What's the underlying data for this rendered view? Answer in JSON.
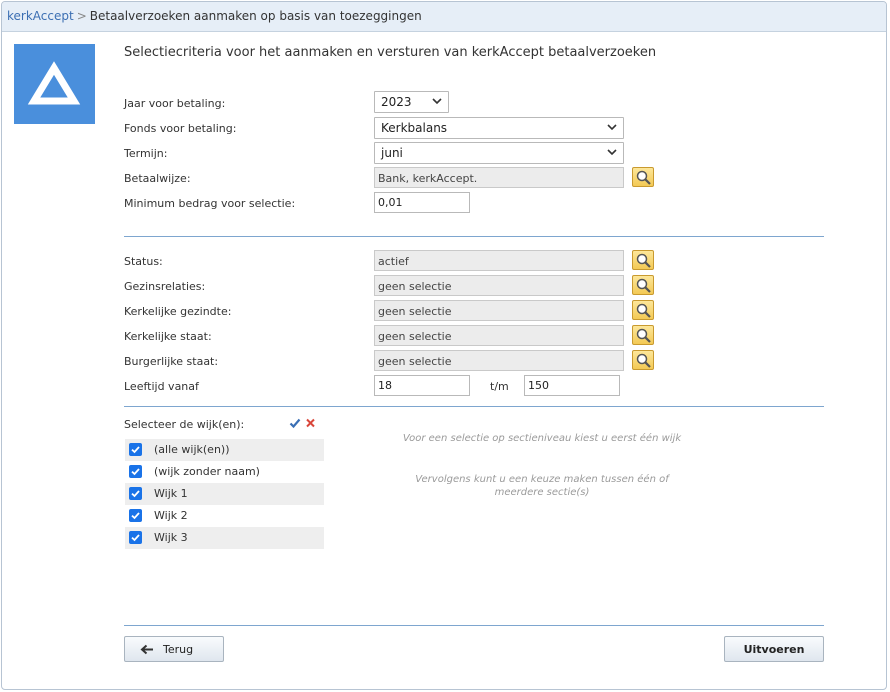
{
  "breadcrumb": {
    "root": "kerkAccept",
    "separator": ">",
    "current": "Betaalverzoeken aanmaken op basis van toezeggingen"
  },
  "page": {
    "title": "Selectiecriteria voor het aanmaken en versturen van kerkAccept betaalverzoeken"
  },
  "criteria": {
    "jaar": {
      "label": "Jaar voor betaling:",
      "value": "2023"
    },
    "fonds": {
      "label": "Fonds voor betaling:",
      "value": "Kerkbalans"
    },
    "termijn": {
      "label": "Termijn:",
      "value": "juni"
    },
    "betaalwijze": {
      "label": "Betaalwijze:",
      "value": "Bank, kerkAccept."
    },
    "minimum": {
      "label": "Minimum bedrag voor selectie:",
      "value": "0,01"
    }
  },
  "filters": {
    "status": {
      "label": "Status:",
      "value": "actief"
    },
    "gezinsrelaties": {
      "label": "Gezinsrelaties:",
      "value": "geen selectie"
    },
    "kerkelijke_gezindte": {
      "label": "Kerkelijke gezindte:",
      "value": "geen selectie"
    },
    "kerkelijke_staat": {
      "label": "Kerkelijke staat:",
      "value": "geen selectie"
    },
    "burgerlijke_staat": {
      "label": "Burgerlijke staat:",
      "value": "geen selectie"
    },
    "leeftijd": {
      "label": "Leeftijd vanaf",
      "from": "18",
      "to_label": "t/m",
      "to": "150"
    }
  },
  "wijken": {
    "label": "Selecteer de wijk(en):",
    "items": [
      {
        "label": "(alle wijk(en))",
        "checked": true
      },
      {
        "label": "(wijk zonder naam)",
        "checked": true
      },
      {
        "label": "Wijk 1",
        "checked": true
      },
      {
        "label": "Wijk 2",
        "checked": true
      },
      {
        "label": "Wijk 3",
        "checked": true
      }
    ],
    "hint1": "Voor een selectie op sectieniveau kiest u eerst één wijk",
    "hint2": "Vervolgens kunt u een keuze maken tussen één of meerdere sectie(s)"
  },
  "buttons": {
    "back": "Terug",
    "execute": "Uitvoeren"
  },
  "colors": {
    "accent": "#4a8fdc",
    "checkbox": "#1a73e8",
    "divider": "#7ea6cf",
    "lookup": "#f3c955"
  }
}
